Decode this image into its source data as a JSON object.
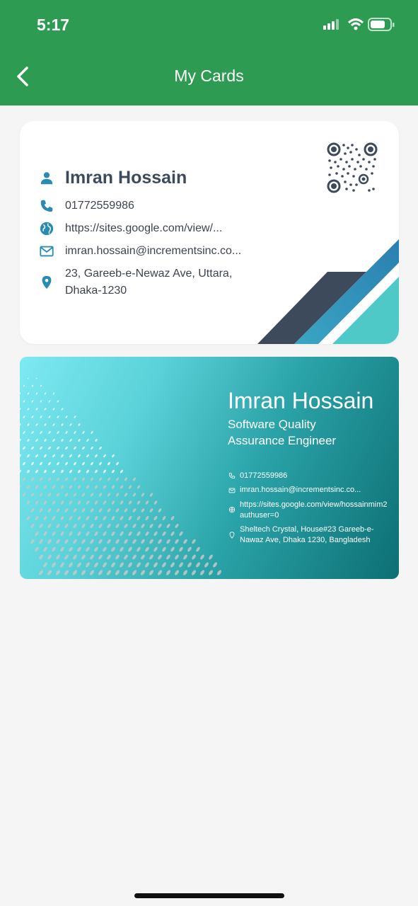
{
  "status_bar": {
    "time": "5:17"
  },
  "header": {
    "title": "My Cards"
  },
  "colors": {
    "header": "#2e9b52",
    "icon_teal": "#2a8bb0",
    "card2_dark": "#0d6f74",
    "card2_light": "#7ee9f2"
  },
  "card1": {
    "name": "Imran Hossain",
    "phone": "01772559986",
    "website": "https://sites.google.com/view/...",
    "email": "imran.hossain@incrementsinc.co...",
    "address_line1": "23, Gareeb-e-Newaz Ave, Uttara,",
    "address_line2": "Dhaka-1230",
    "icons": [
      "person-icon",
      "phone-icon",
      "globe-icon",
      "email-icon",
      "location-icon"
    ]
  },
  "card2": {
    "name": "Imran Hossain",
    "role_line1": "Software Quality",
    "role_line2": "Assurance Engineer",
    "phone": "01772559986",
    "email": "imran.hossain@incrementsinc.co...",
    "website_line1": "https://sites.google.com/view/hossainmim2",
    "website_line2": "authuser=0",
    "address_line1": "Sheltech Crystal, House#23 Gareeb-e-",
    "address_line2": "Nawaz Ave, Dhaka 1230, Bangladesh"
  }
}
